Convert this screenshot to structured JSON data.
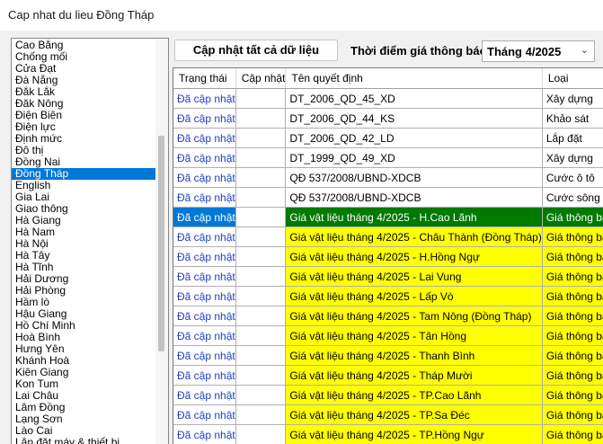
{
  "window": {
    "title": "Cap nhat du lieu Đồng Tháp"
  },
  "province_list": {
    "selected": "Đồng Tháp",
    "items": [
      "Cao Bằng",
      "Chống mối",
      "Cửa Đạt",
      "Đà Nẵng",
      "Đắk Lắk",
      "Đăk Nông",
      "Điện Biên",
      "Điện lực",
      "Định mức",
      "Đô thị",
      "Đồng Nai",
      "Đồng Tháp",
      "English",
      "Gia Lai",
      "Giao thông",
      "Hà Giang",
      "Hà Nam",
      "Hà Nội",
      "Hà Tây",
      "Hà Tĩnh",
      "Hải Dương",
      "Hải Phòng",
      "Hầm lò",
      "Hậu Giang",
      "Hồ Chí Minh",
      "Hoà Bình",
      "Hưng Yên",
      "Khánh Hoà",
      "Kiên Giang",
      "Kon Tum",
      "Lai Châu",
      "Lâm Đồng",
      "Lạng Sơn",
      "Lào Cai",
      "Lắp đặt máy & thiết bị"
    ]
  },
  "toolbar": {
    "update_all_label": "Cập nhật tất cả dữ liệu",
    "time_label": "Thời điểm giá thông báo",
    "time_value": "Tháng 4/2025"
  },
  "grid": {
    "headers": [
      "Trạng thái",
      "Cập nhật",
      "Tên quyết định",
      "Loại"
    ],
    "rows": [
      {
        "status": "Đã cập nhật",
        "update": "",
        "name": "DT_2006_QD_45_XD",
        "type": "Xây dựng",
        "hl": ""
      },
      {
        "status": "Đã cập nhật",
        "update": "",
        "name": "DT_2006_QD_44_KS",
        "type": "Khảo sát",
        "hl": ""
      },
      {
        "status": "Đã cập nhật",
        "update": "",
        "name": "DT_2006_QD_42_LD",
        "type": "Lắp đặt",
        "hl": ""
      },
      {
        "status": "Đã cập nhật",
        "update": "",
        "name": "DT_1999_QD_49_XD",
        "type": "Xây dựng",
        "hl": ""
      },
      {
        "status": "Đã cập nhật",
        "update": "",
        "name": "QĐ 537/2008/UBND-XDCB",
        "type": "Cước ô tô",
        "hl": ""
      },
      {
        "status": "Đã cập nhật",
        "update": "",
        "name": "QĐ 537/2008/UBND-XDCB",
        "type": "Cước sông",
        "hl": ""
      },
      {
        "status": "Đã cập nhật",
        "update": "",
        "name": "Giá vật liệu tháng 4/2025 - H.Cao Lãnh",
        "type": "Giá thông báo",
        "hl": "green"
      },
      {
        "status": "Đã cập nhật",
        "update": "",
        "name": "Giá vật liệu tháng 4/2025 - Châu Thành (Đồng Tháp)",
        "type": "Giá thông báo",
        "hl": "yellow"
      },
      {
        "status": "Đã cập nhật",
        "update": "",
        "name": "Giá vật liệu tháng 4/2025 - H.Hồng Ngự",
        "type": "Giá thông báo",
        "hl": "yellow"
      },
      {
        "status": "Đã cập nhật",
        "update": "",
        "name": "Giá vật liệu tháng 4/2025 - Lai Vung",
        "type": "Giá thông báo",
        "hl": "yellow"
      },
      {
        "status": "Đã cập nhật",
        "update": "",
        "name": "Giá vật liệu tháng 4/2025 - Lấp Vò",
        "type": "Giá thông báo",
        "hl": "yellow"
      },
      {
        "status": "Đã cập nhật",
        "update": "",
        "name": "Giá vật liệu tháng 4/2025 - Tam Nông (Đồng Tháp)",
        "type": "Giá thông báo",
        "hl": "yellow"
      },
      {
        "status": "Đã cập nhật",
        "update": "",
        "name": "Giá vật liệu tháng 4/2025 - Tân Hồng",
        "type": "Giá thông báo",
        "hl": "yellow"
      },
      {
        "status": "Đã cập nhật",
        "update": "",
        "name": "Giá vật liệu tháng 4/2025 - Thanh Bình",
        "type": "Giá thông báo",
        "hl": "yellow"
      },
      {
        "status": "Đã cập nhật",
        "update": "",
        "name": "Giá vật liệu tháng 4/2025 - Tháp Mười",
        "type": "Giá thông báo",
        "hl": "yellow"
      },
      {
        "status": "Đã cập nhật",
        "update": "",
        "name": "Giá vật liệu tháng 4/2025 - TP.Cao Lãnh",
        "type": "Giá thông báo",
        "hl": "yellow"
      },
      {
        "status": "Đã cập nhật",
        "update": "",
        "name": "Giá vật liệu tháng 4/2025 - TP.Sa Đéc",
        "type": "Giá thông báo",
        "hl": "yellow"
      },
      {
        "status": "Đã cập nhật",
        "update": "",
        "name": "Giá vật liệu tháng 4/2025 - TP.Hồng Ngự",
        "type": "Giá thông báo",
        "hl": "yellow"
      }
    ]
  }
}
